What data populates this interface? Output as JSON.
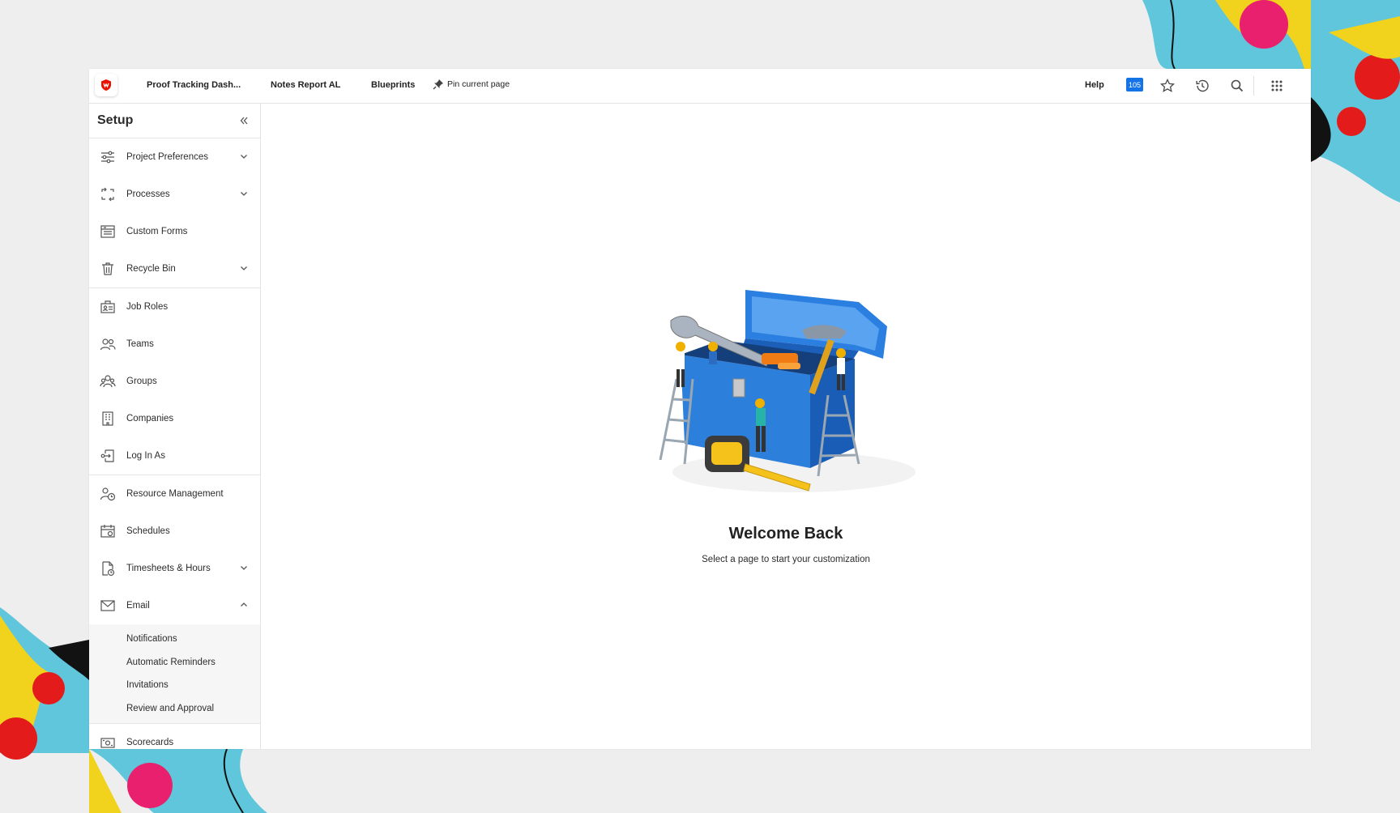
{
  "topbar": {
    "tabs": [
      {
        "label": "Proof Tracking Dash..."
      },
      {
        "label": "Notes Report AL"
      },
      {
        "label": "Blueprints"
      }
    ],
    "pin_label": "Pin current page",
    "help_label": "Help",
    "notification_count": "105"
  },
  "sidebar": {
    "title": "Setup",
    "groups": [
      {
        "items": [
          {
            "label": "Project Preferences",
            "icon": "sliders-icon",
            "expandable": true
          },
          {
            "label": "Processes",
            "icon": "processes-icon",
            "expandable": true
          },
          {
            "label": "Custom Forms",
            "icon": "forms-icon",
            "expandable": false
          },
          {
            "label": "Recycle Bin",
            "icon": "trash-icon",
            "expandable": true
          }
        ]
      },
      {
        "items": [
          {
            "label": "Job Roles",
            "icon": "job-roles-icon"
          },
          {
            "label": "Teams",
            "icon": "teams-icon"
          },
          {
            "label": "Groups",
            "icon": "groups-icon"
          },
          {
            "label": "Companies",
            "icon": "building-icon"
          },
          {
            "label": "Log In As",
            "icon": "login-as-icon"
          }
        ]
      },
      {
        "items": [
          {
            "label": "Resource Management",
            "icon": "resource-icon"
          },
          {
            "label": "Schedules",
            "icon": "calendar-icon"
          },
          {
            "label": "Timesheets & Hours",
            "icon": "timesheet-icon",
            "expandable": true
          },
          {
            "label": "Email",
            "icon": "mail-icon",
            "expanded": true
          }
        ]
      }
    ],
    "email_sub": [
      "Notifications",
      "Automatic Reminders",
      "Invitations",
      "Review and Approval"
    ],
    "after": {
      "label": "Scorecards",
      "icon": "scorecard-icon"
    }
  },
  "main": {
    "heading": "Welcome Back",
    "subtext": "Select a page to start your customization"
  },
  "colors": {
    "accent": "#1473e6",
    "logo": "#eb1000"
  }
}
